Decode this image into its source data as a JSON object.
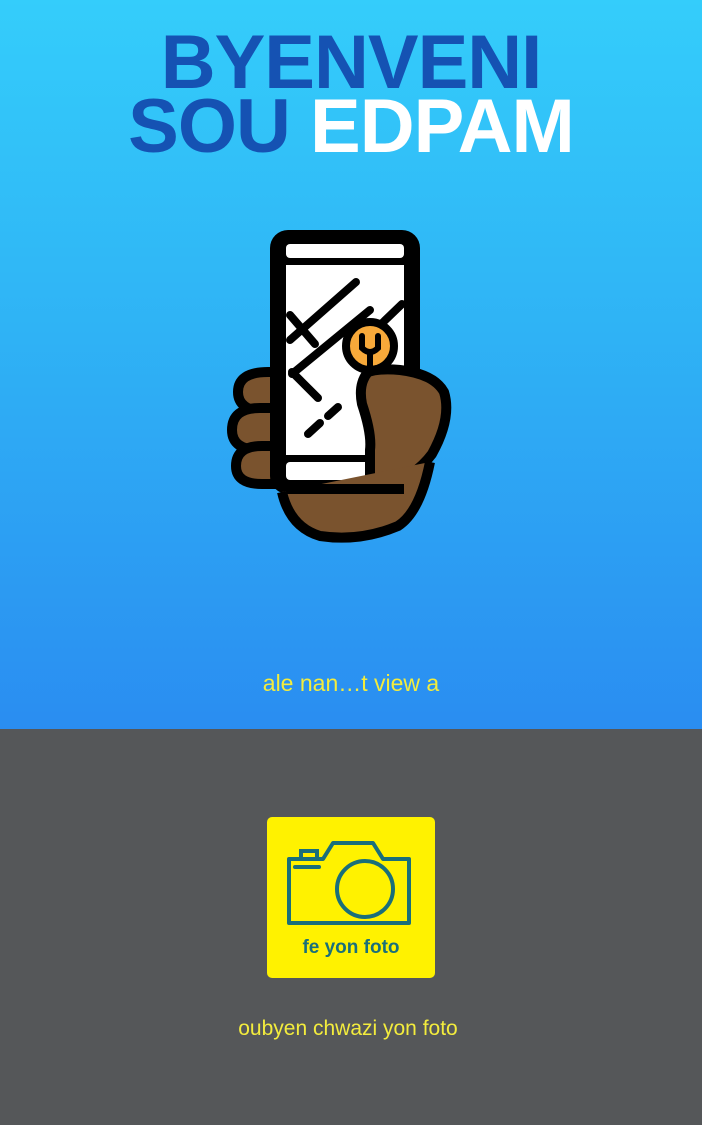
{
  "header": {
    "title_line1": "BYENVENI",
    "title_line2_prefix": "SOU",
    "title_line2_accent": "EDPAM"
  },
  "hero": {
    "illustration_icon": "hand-holding-phone-with-map-pin-icon",
    "ar_link_label": "ale nan…t view a"
  },
  "photo": {
    "take_photo_label": "fe yon  foto",
    "camera_icon": "camera-icon",
    "choose_photo_label": "oubyen chwazi yon foto"
  },
  "colors": {
    "hero_top": "#34cdfb",
    "hero_bottom": "#2a8df1",
    "title_blue": "#1552b3",
    "link_yellow": "#f3ec3d",
    "button_yellow": "#fff200",
    "bottom_gray": "#555759",
    "pin_orange": "#f7a93a",
    "skin_brown": "#7a532e"
  }
}
